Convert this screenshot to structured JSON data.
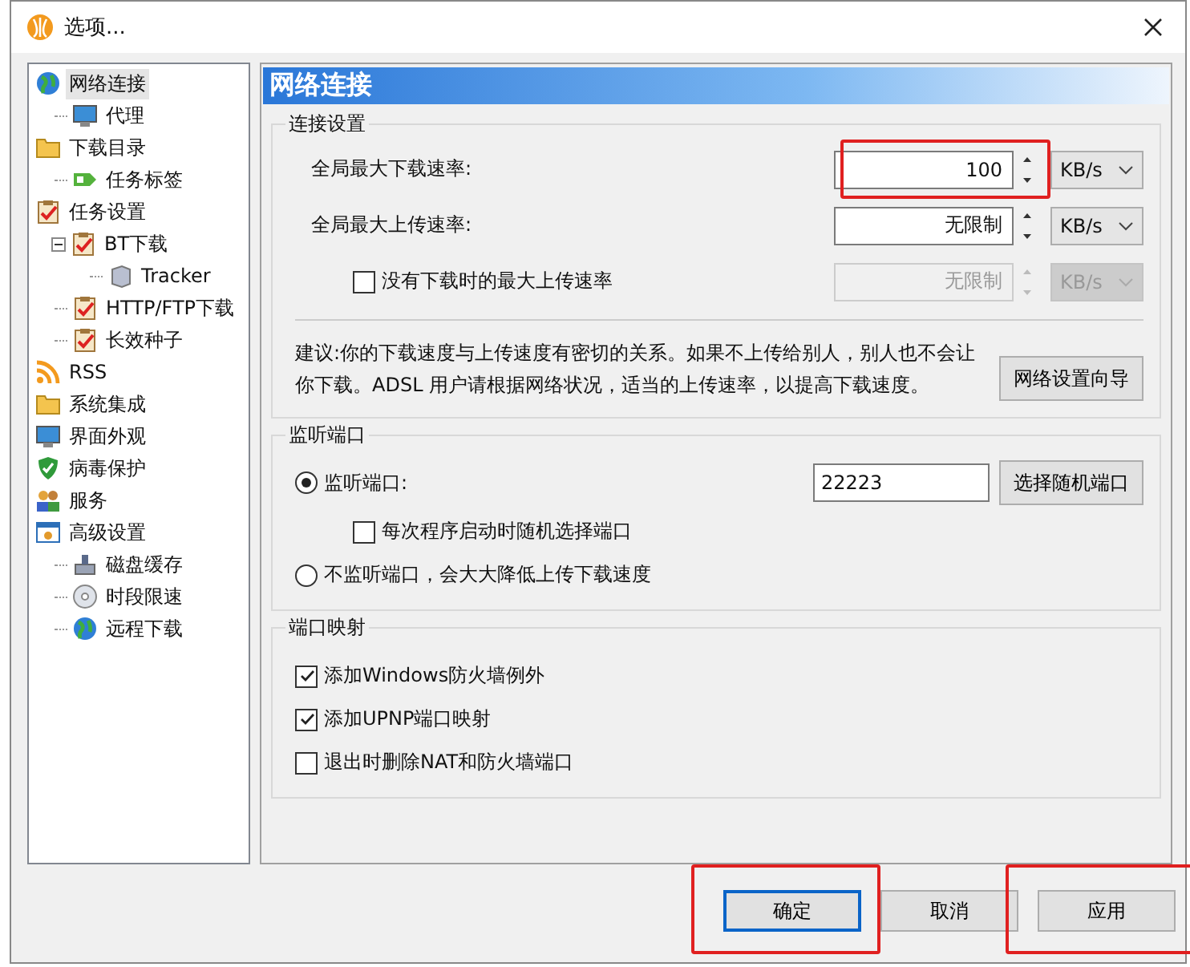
{
  "window": {
    "title": "选项..."
  },
  "tree": [
    {
      "label": "网络连接",
      "selected": true,
      "children": [
        {
          "label": "代理",
          "selected": false
        }
      ]
    },
    {
      "label": "下载目录",
      "selected": false,
      "children": [
        {
          "label": "任务标签",
          "selected": false
        }
      ]
    },
    {
      "label": "任务设置",
      "selected": false,
      "children": [
        {
          "label": "BT下载",
          "selected": false,
          "expanded": true,
          "children": [
            {
              "label": "Tracker",
              "selected": false
            }
          ]
        },
        {
          "label": "HTTP/FTP下载",
          "selected": false
        },
        {
          "label": "长效种子",
          "selected": false
        }
      ]
    },
    {
      "label": "RSS",
      "selected": false
    },
    {
      "label": "系统集成",
      "selected": false
    },
    {
      "label": "界面外观",
      "selected": false
    },
    {
      "label": "病毒保护",
      "selected": false
    },
    {
      "label": "服务",
      "selected": false
    },
    {
      "label": "高级设置",
      "selected": false,
      "children": [
        {
          "label": "磁盘缓存",
          "selected": false
        },
        {
          "label": "时段限速",
          "selected": false
        },
        {
          "label": "远程下载",
          "selected": false
        }
      ]
    }
  ],
  "panel": {
    "title": "网络连接",
    "connection": {
      "legend": "连接设置",
      "rates": [
        {
          "kind": "plain",
          "label": "全局最大下载速率:",
          "value": "100",
          "unit": "KB/s",
          "disabled": false,
          "highlighted": true
        },
        {
          "kind": "plain",
          "label": "全局最大上传速率:",
          "value": "无限制",
          "unit": "KB/s",
          "disabled": false,
          "highlighted": false
        },
        {
          "kind": "checkbox",
          "label": "没有下载时的最大上传速率",
          "checked": false,
          "value": "无限制",
          "unit": "KB/s",
          "disabled": true,
          "highlighted": false
        }
      ],
      "advice": "建议:你的下载速度与上传速度有密切的关系。如果不上传给别人，别人也不会让你下载。ADSL 用户请根据网络状况，适当的上传速率，以提高下载速度。",
      "wizard_button": "网络设置向导"
    },
    "listen": {
      "legend": "监听端口",
      "listen_radio": {
        "label": "监听端口:",
        "selected": true
      },
      "port": "22223",
      "random_button": "选择随机端口",
      "random_each_start": {
        "label": "每次程序启动时随机选择端口",
        "checked": false
      },
      "no_listen_radio": {
        "label": "不监听端口，会大大降低上传下载速度",
        "selected": false
      }
    },
    "mapping": {
      "legend": "端口映射",
      "options": [
        {
          "label": "添加Windows防火墙例外",
          "checked": true
        },
        {
          "label": "添加UPNP端口映射",
          "checked": true
        },
        {
          "label": "退出时删除NAT和防火墙端口",
          "checked": false
        }
      ]
    }
  },
  "buttons": [
    {
      "label": "确定",
      "default": true,
      "highlighted": true
    },
    {
      "label": "取消",
      "default": false,
      "highlighted": false
    },
    {
      "label": "应用",
      "default": false,
      "highlighted": true
    }
  ]
}
